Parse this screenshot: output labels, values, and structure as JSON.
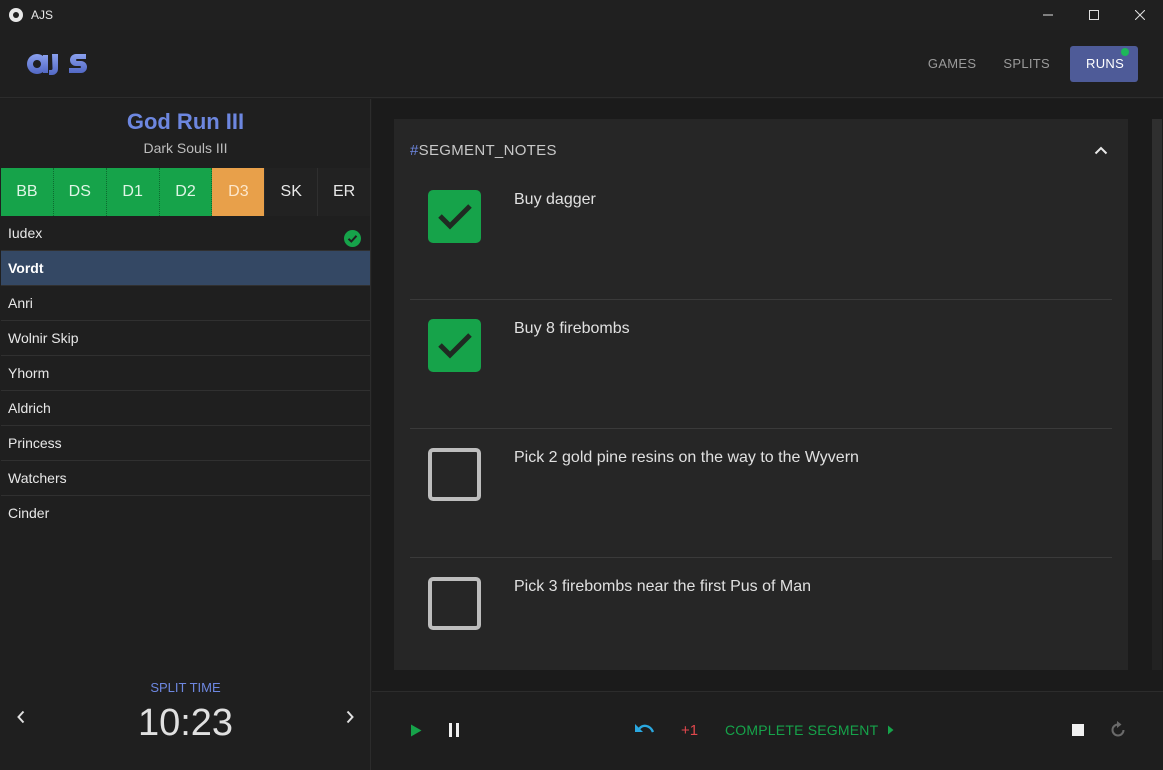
{
  "window": {
    "title": "AJS"
  },
  "header": {
    "logo_text": "AJS",
    "nav": [
      {
        "label": "GAMES",
        "active": false
      },
      {
        "label": "SPLITS",
        "active": false
      },
      {
        "label": "RUNS",
        "active": true
      }
    ],
    "runs_indicator_color": "#1db75a"
  },
  "run": {
    "title": "God Run III",
    "game": "Dark Souls III"
  },
  "tabs": [
    {
      "label": "BB",
      "state": "done"
    },
    {
      "label": "DS",
      "state": "done"
    },
    {
      "label": "D1",
      "state": "done"
    },
    {
      "label": "D2",
      "state": "done"
    },
    {
      "label": "D3",
      "state": "current"
    },
    {
      "label": "SK",
      "state": "todo"
    },
    {
      "label": "ER",
      "state": "todo"
    }
  ],
  "segments": [
    {
      "label": "Iudex",
      "completed": true,
      "active": false
    },
    {
      "label": "Vordt",
      "completed": false,
      "active": true
    },
    {
      "label": "Anri",
      "completed": false,
      "active": false
    },
    {
      "label": "Wolnir Skip",
      "completed": false,
      "active": false
    },
    {
      "label": "Yhorm",
      "completed": false,
      "active": false
    },
    {
      "label": "Aldrich",
      "completed": false,
      "active": false
    },
    {
      "label": "Princess",
      "completed": false,
      "active": false
    },
    {
      "label": "Watchers",
      "completed": false,
      "active": false
    },
    {
      "label": "Cinder",
      "completed": false,
      "active": false
    }
  ],
  "split": {
    "label": "SPLIT TIME",
    "time": "10:23"
  },
  "notes": {
    "hash": "#",
    "title": "SEGMENT_NOTES",
    "items": [
      {
        "text": "Buy dagger",
        "checked": true
      },
      {
        "text": "Buy 8 firebombs",
        "checked": true
      },
      {
        "text": "Pick 2 gold pine resins on the way to the Wyvern",
        "checked": false
      },
      {
        "text": "Pick 3 firebombs near the first Pus of Man",
        "checked": false
      }
    ]
  },
  "controls": {
    "plus_one": "+1",
    "complete_segment": "COMPLETE SEGMENT"
  },
  "colors": {
    "accent": "#6d87e0",
    "done": "#16a34a",
    "current": "#e8a04a",
    "penalty": "#e0474c",
    "undo": "#2aa8e0"
  }
}
